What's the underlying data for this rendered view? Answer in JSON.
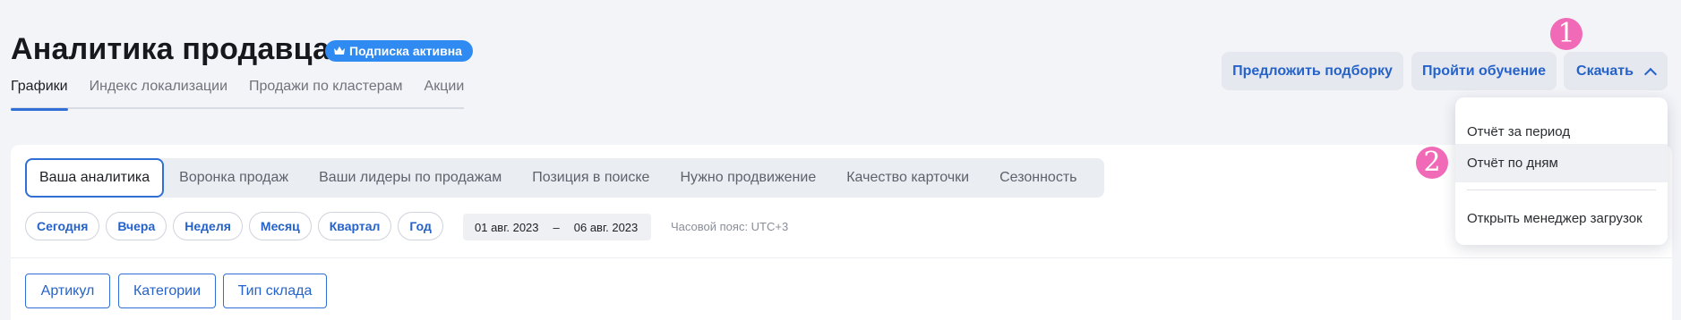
{
  "header": {
    "title": "Аналитика продавца",
    "badge": "Подписка активна",
    "tabs": [
      "Графики",
      "Индекс локализации",
      "Продажи по кластерам",
      "Акции"
    ],
    "buttons": {
      "suggest": "Предложить подборку",
      "training": "Пройти обучение",
      "download": "Скачать"
    }
  },
  "download_menu": {
    "items": [
      "Отчёт за период",
      "Отчёт по дням",
      "Открыть менеджер загрузок"
    ]
  },
  "markers": [
    "1",
    "2"
  ],
  "analytics_tabs": [
    "Ваша аналитика",
    "Воронка продаж",
    "Ваши лидеры по продажам",
    "Позиция в поиске",
    "Нужно продвижение",
    "Качество карточки",
    "Сезонность"
  ],
  "period_pills": [
    "Сегодня",
    "Вчера",
    "Неделя",
    "Месяц",
    "Квартал",
    "Год"
  ],
  "date_range": {
    "from": "01 авг. 2023",
    "separator": "–",
    "to": "06 авг. 2023"
  },
  "timezone": "Часовой пояс: UTC+3",
  "filters": [
    "Артикул",
    "Категории",
    "Тип склада"
  ],
  "colors": {
    "accent": "#2f6fd6",
    "badge": "#2f8bf2",
    "marker": "#f06ab7"
  }
}
